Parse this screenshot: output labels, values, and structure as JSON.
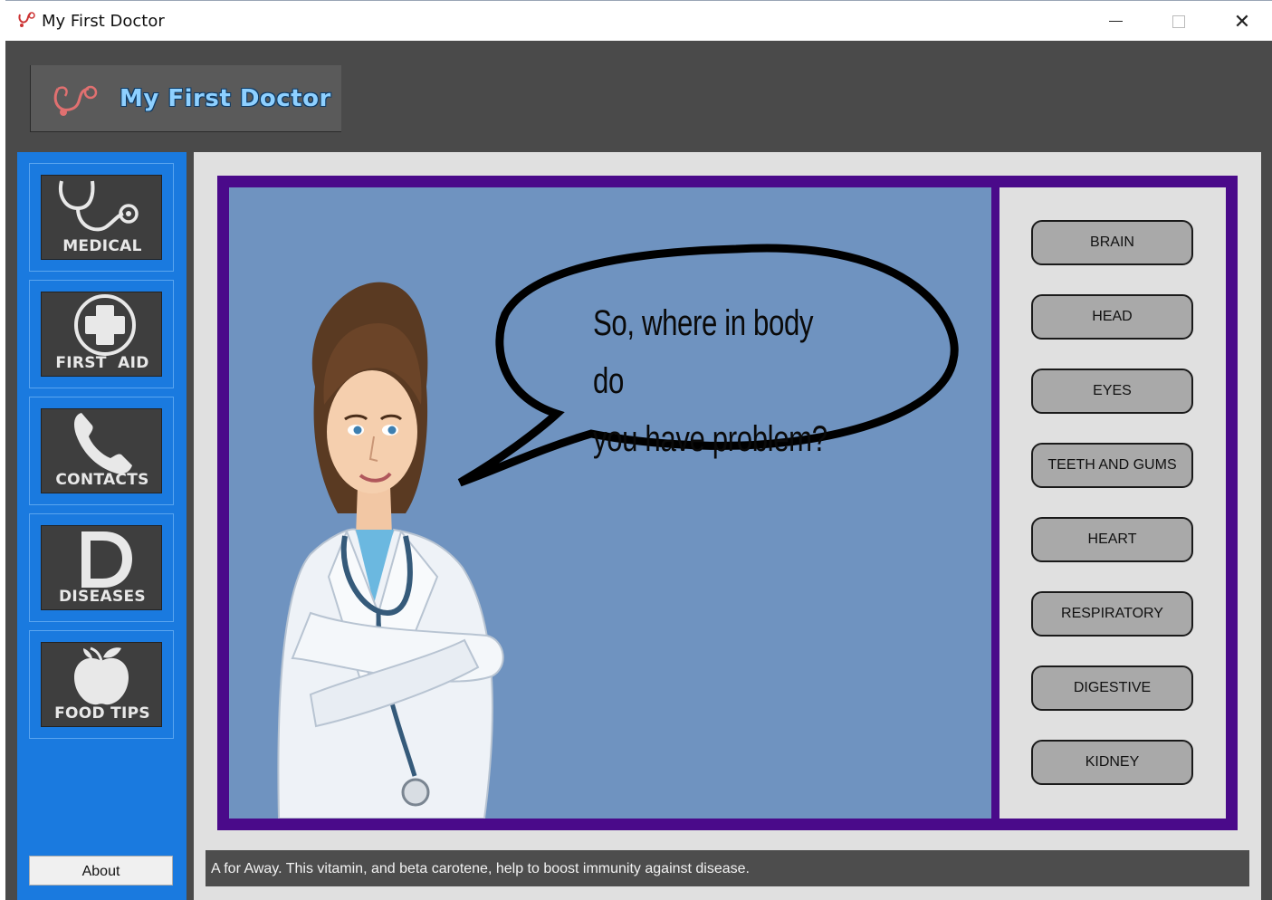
{
  "window": {
    "title": "My First Doctor"
  },
  "logo": {
    "text": "My First Doctor"
  },
  "sidebar": {
    "items": [
      {
        "label": "MEDICAL",
        "icon": "stethoscope-icon"
      },
      {
        "label": "FIRST  AID",
        "icon": "first-aid-cross-icon"
      },
      {
        "label": "CONTACTS",
        "icon": "phone-icon"
      },
      {
        "label": "DISEASES",
        "icon": "letter-d-icon"
      },
      {
        "label": "FOOD TIPS",
        "icon": "apple-icon"
      }
    ],
    "about_label": "About"
  },
  "scene": {
    "speech": "So, where in body do you have problem?",
    "speech_line1": "So, where in body do",
    "speech_line2": "you have problem?"
  },
  "body_parts": [
    {
      "label": "BRAIN"
    },
    {
      "label": "HEAD"
    },
    {
      "label": "EYES"
    },
    {
      "label": "TEETH AND GUMS"
    },
    {
      "label": "HEART"
    },
    {
      "label": "RESPIRATORY"
    },
    {
      "label": "DIGESTIVE"
    },
    {
      "label": "KIDNEY"
    }
  ],
  "status": {
    "text": "A for Away. This vitamin, and beta carotene, help to boost immunity against disease."
  },
  "colors": {
    "sidebar": "#1a7adf",
    "frame": "#4a0a8a",
    "scene_bg": "#6f93c0",
    "logo_text": "#8ed0ff"
  }
}
